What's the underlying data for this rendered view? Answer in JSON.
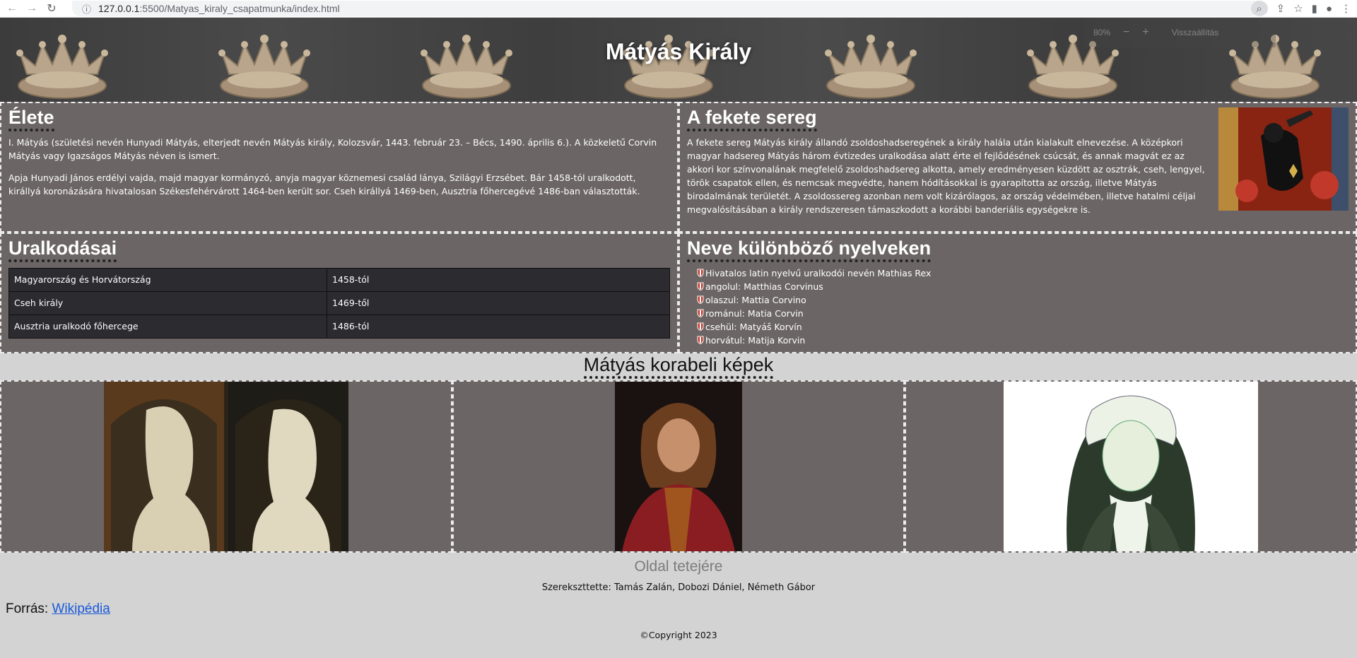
{
  "browser": {
    "url_host": "127.0.0.1",
    "url_path": ":5500/Matyas_kiraly_csapatmunka/index.html",
    "zoom_popup": {
      "percent": "80%",
      "minus": "−",
      "plus": "+",
      "reset": "Visszaállítás"
    }
  },
  "header": {
    "title": "Mátyás Király"
  },
  "elete": {
    "heading": "Élete",
    "p1": "I. Mátyás (születési nevén Hunyadi Mátyás, elterjedt nevén Mátyás király, Kolozsvár, 1443. február 23. – Bécs, 1490. április 6.). A közkeletű Corvin Mátyás vagy Igazságos Mátyás néven is ismert.",
    "p2": "Apja Hunyadi János erdélyi vajda, majd magyar kormányzó, anyja magyar köznemesi család lánya, Szilágyi Erzsébet. Bár 1458-tól uralkodott, királlyá koronázására hivatalosan Székesfehérvárott 1464-ben került sor. Cseh királlyá 1469-ben, Ausztria főhercegévé 1486-ban választották."
  },
  "fekete_sereg": {
    "heading": "A fekete sereg",
    "text": "A fekete sereg Mátyás király állandó zsoldoshadseregének a király halála után kialakult elnevezése. A középkori magyar hadsereg Mátyás három évtizedes uralkodása alatt érte el fejlődésének csúcsát, és annak magvát ez az akkori kor színvonalának megfelelő zsoldoshadsereg alkotta, amely eredményesen küzdött az osztrák, cseh, lengyel, török csapatok ellen, és nemcsak megvédte, hanem hódításokkal is gyarapította az ország, illetve Mátyás birodalmának területét. A zsoldossereg azonban nem volt kizárólagos, az ország védelmében, illetve hatalmi céljai megvalósításában a király rendszeresen támaszkodott a korábbi banderiális egységekre is."
  },
  "uralkodasai": {
    "heading": "Uralkodásai",
    "rows": [
      {
        "title": "Magyarország és Horvátország",
        "years": "1458-tól"
      },
      {
        "title": "Cseh király",
        "years": "1469-től"
      },
      {
        "title": "Ausztria uralkodó főhercege",
        "years": "1486-tól"
      }
    ]
  },
  "nevek": {
    "heading": "Neve különböző nyelveken",
    "items": [
      "Hivatalos latin nyelvű uralkodói nevén Mathias Rex",
      "angolul: Matthias Corvinus",
      "olaszul: Mattia Corvino",
      "románul: Matia Corvin",
      "csehül: Matyáš Korvín",
      "horvátul: Matija Korvin"
    ]
  },
  "gallery": {
    "heading": "Mátyás korabeli képek"
  },
  "footer": {
    "top_link": "Oldal tetejére",
    "editors": "Szerekszttette: Tamás Zalán, Dobozi Dániel, Németh Gábor",
    "source_label": "Forrás:",
    "source_link": "Wikipédia",
    "copyright": "©Copyright 2023"
  }
}
